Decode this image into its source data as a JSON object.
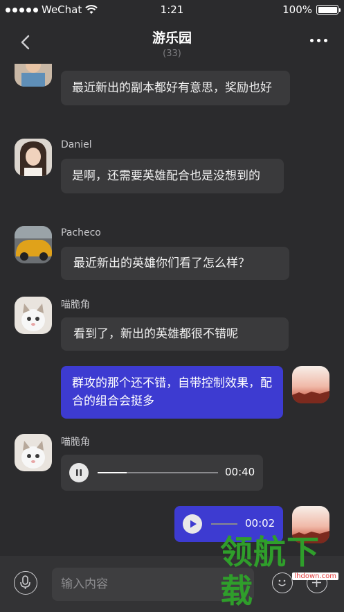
{
  "status_bar": {
    "carrier": "WeChat",
    "time": "1:21",
    "battery": "100%"
  },
  "nav": {
    "title": "游乐园",
    "member_count": "(33)"
  },
  "messages": [
    {
      "text": "最近新出的副本都好有意思，奖励也好"
    },
    {
      "sender": "Daniel",
      "text": "是啊，还需要英雄配合也是没想到的"
    },
    {
      "sender": "Pacheco",
      "text": "最近新出的英雄你们看了怎么样？"
    },
    {
      "sender": "喵脆角",
      "text": "看到了，新出的英雄都很不错呢"
    },
    {
      "text": "群攻的那个还不错，自带控制效果，配合的组合会挺多"
    },
    {
      "sender": "喵脆角",
      "voice_duration": "00:40",
      "progress": 0.24
    },
    {
      "voice_duration": "00:02",
      "progress": 0.0
    }
  ],
  "input": {
    "placeholder": "输入内容"
  },
  "watermark": {
    "text": "领航下载",
    "url": "lhdown.com"
  },
  "colors": {
    "background": "#2b2b2d",
    "bubble_other": "#3a3a3c",
    "bubble_mine": "#3d3bd1",
    "input_bar": "#333335"
  }
}
